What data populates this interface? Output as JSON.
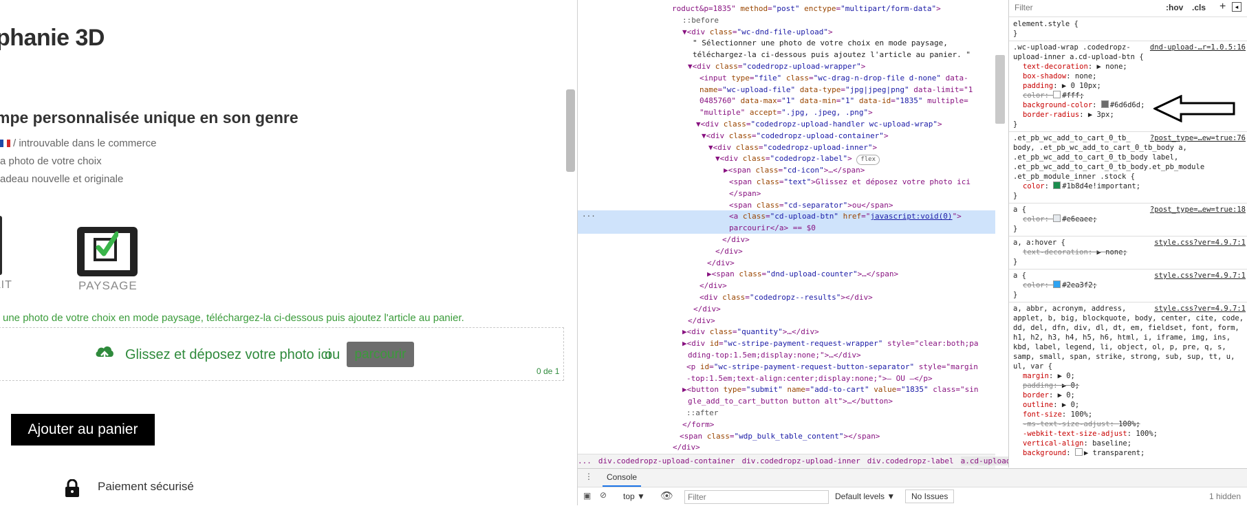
{
  "page": {
    "title": "phanie 3D",
    "subtitle": "mpe personnalisée unique en son genre",
    "features": [
      "/ introuvable dans le commerce",
      "a photo de votre choix",
      "adeau nouvelle et originale"
    ],
    "portrait_label": "AIT",
    "paysage_label": "PAYSAGE",
    "instruction": "une photo de votre choix en mode paysage, téléchargez-la ci-dessous puis ajoutez l'article au panier.",
    "drop_text": "Glissez et déposez votre photo ici",
    "separator": "ou",
    "browse_label": "parcourir",
    "counter": "0 de 1",
    "add_to_cart": "Ajouter au panier",
    "secure_payment": "Paiement sécurisé",
    "colors": {
      "accent_green": "#2f8a3c",
      "browse_bg": "#6d6d6d"
    }
  },
  "devtools": {
    "elements_lines": [
      {
        "t": "roduct&p=1835\" method=\"post\" enctype=\"multipart/form-data\">"
      },
      {
        "t": "::before"
      },
      {
        "t": "▼<div class=\"wc-dnd-file-upload\">"
      },
      {
        "t": "\" Sélectionner une photo de votre choix en mode paysage,"
      },
      {
        "t": "téléchargez-la ci-dessous puis ajoutez l'article au panier. \""
      },
      {
        "t": "▼<div class=\"codedropz-upload-wrapper\">"
      },
      {
        "t": "<input type=\"file\" class=\"wc-drag-n-drop-file d-none\" data-"
      },
      {
        "t": "name=\"wc-upload-file\" data-type=\"jpg|jpeg|png\" data-limit=\"1"
      },
      {
        "t": "0485760\" data-max=\"1\" data-min=\"1\" data-id=\"1835\" multiple="
      },
      {
        "t": "\"multiple\" accept=\".jpg, .jpeg, .png\">"
      },
      {
        "t": "▼<div class=\"codedropz-upload-handler wc-upload-wrap\">"
      },
      {
        "t": "▼<div class=\"codedropz-upload-container\">"
      },
      {
        "t": "▼<div class=\"codedropz-upload-inner\">"
      },
      {
        "t": "▼<div class=\"codedropz-label\">"
      },
      {
        "t": "▶<span class=\"cd-icon\">…</span>"
      },
      {
        "t": "<span class=\"text\">Glissez et déposez votre photo ici"
      },
      {
        "t": "</span>"
      },
      {
        "t": "<span class=\"cd-separator\">ou</span>"
      },
      {
        "t": "<a class=\"cd-upload-btn\" href=\"javascript:void(0)\">"
      },
      {
        "t": "parcourir</a> == $0"
      },
      {
        "t": "</div>"
      },
      {
        "t": "</div>"
      },
      {
        "t": "</div>"
      },
      {
        "t": "▶<span class=\"dnd-upload-counter\">…</span>"
      },
      {
        "t": "</div>"
      },
      {
        "t": "<div class=\"codedropz--results\"></div>"
      },
      {
        "t": "</div>"
      },
      {
        "t": "</div>"
      },
      {
        "t": "▶<div class=\"quantity\">…</div>"
      },
      {
        "t": "▶<div id=\"wc-stripe-payment-request-wrapper\" style=\"clear:both;pa"
      },
      {
        "t": "dding-top:1.5em;display:none;\">…</div>"
      },
      {
        "t": "<p id=\"wc-stripe-payment-request-button-separator\" style=\"margin"
      },
      {
        "t": "-top:1.5em;text-align:center;display:none;\">— OU —</p>"
      },
      {
        "t": "▶<button type=\"submit\" name=\"add-to-cart\" value=\"1835\" class=\"sin"
      },
      {
        "t": "gle_add_to_cart_button button alt\">…</button>"
      },
      {
        "t": "::after"
      },
      {
        "t": "</form>"
      },
      {
        "t": "<span class=\"wdp_bulk_table_content\"></span>"
      },
      {
        "t": "</div>"
      }
    ],
    "flex_badge": "flex",
    "breadcrumbs": [
      "...",
      "div.codedropz-upload-container",
      "div.codedropz-upload-inner",
      "div.codedropz-label",
      "a.cd-upload-btn",
      "..."
    ],
    "drawer_tab": "Console",
    "console": {
      "context": "top ▼",
      "filter_placeholder": "Filter",
      "levels": "Default levels ▼",
      "issues": "No Issues",
      "hidden": "1 hidden"
    },
    "styles": {
      "filter_placeholder": "Filter",
      "hov": ":hov",
      "cls": ".cls",
      "lines": [
        {
          "s": "element.style {"
        },
        {
          "s": "}"
        },
        {
          "s": ".wc-upload-wrap .codedropz-",
          "src": "dnd-upload-…r=1.0.5:16"
        },
        {
          "s": "upload-inner a.cd-upload-btn {"
        },
        {
          "p": "text-decoration",
          "v": "▶ none;"
        },
        {
          "p": "box-shadow",
          "v": "none;"
        },
        {
          "p": "padding",
          "v": "▶ 0 10px;"
        },
        {
          "p": "color",
          "v": "#fff;",
          "strike": true,
          "sw": "#ffffff"
        },
        {
          "p": "background-color",
          "v": "#6d6d6d;",
          "sw": "#6d6d6d"
        },
        {
          "p": "border-radius",
          "v": "▶ 3px;"
        },
        {
          "s": "}"
        },
        {
          "s": ".et_pb_wc_add_to_cart_0_tb_",
          "src": "?post_type=…ew=true:76"
        },
        {
          "s": "body, .et_pb_wc_add_to_cart_0_tb_body a,"
        },
        {
          "s": ".et_pb_wc_add_to_cart_0_tb_body label,"
        },
        {
          "s": ".et_pb_wc_add_to_cart_0_tb_body.et_pb_module"
        },
        {
          "s": ".et_pb_module_inner .stock {"
        },
        {
          "p": "color",
          "v": "#1b8d4e!important;",
          "sw": "#1b8d4e"
        },
        {
          "s": "}"
        },
        {
          "s": "a {",
          "src": "?post_type=…ew=true:18"
        },
        {
          "p": "color",
          "v": "#e6eaee;",
          "strike": true,
          "sw": "#e6eaee"
        },
        {
          "s": "}"
        },
        {
          "s": "a, a:hover {",
          "src": "style.css?ver=4.9.7:1"
        },
        {
          "p": "text-decoration",
          "v": "▶ none;",
          "strike": true
        },
        {
          "s": "}"
        },
        {
          "s": "a {",
          "src": "style.css?ver=4.9.7:1"
        },
        {
          "p": "color",
          "v": "#2ea3f2;",
          "strike": true,
          "sw": "#2ea3f2"
        },
        {
          "s": "}"
        },
        {
          "s": "a, abbr, acronym, address,",
          "src": "style.css?ver=4.9.7:1"
        },
        {
          "s": "applet, b, big, blockquote, body, center, cite, code,"
        },
        {
          "s": "dd, del, dfn, div, dl, dt, em, fieldset, font, form,"
        },
        {
          "s": "h1, h2, h3, h4, h5, h6, html, i, iframe, img, ins,"
        },
        {
          "s": "kbd, label, legend, li, object, ol, p, pre, q, s,"
        },
        {
          "s": "samp, small, span, strike, strong, sub, sup, tt, u,"
        },
        {
          "s": "ul, var {"
        },
        {
          "p": "margin",
          "v": "▶ 0;"
        },
        {
          "p": "padding",
          "v": "▶ 0;",
          "strike": true
        },
        {
          "p": "border",
          "v": "▶ 0;"
        },
        {
          "p": "outline",
          "v": "▶ 0;"
        },
        {
          "p": "font-size",
          "v": "100%;"
        },
        {
          "p": "-ms-text-size-adjust",
          "v": "100%;",
          "strike": true
        },
        {
          "p": "-webkit-text-size-adjust",
          "v": "100%;"
        },
        {
          "p": "vertical-align",
          "v": "baseline;"
        },
        {
          "p": "background",
          "v": "▶ transparent;",
          "sw": "#ffffff"
        }
      ]
    }
  }
}
